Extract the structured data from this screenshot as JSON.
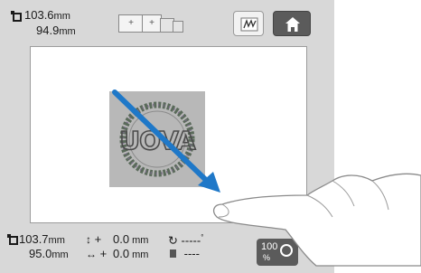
{
  "top": {
    "design_width": "103.6",
    "design_height": "94.9",
    "unit": "mm",
    "hoop_small_label": "+",
    "hoop_large_label": "+"
  },
  "bottom": {
    "width_value": "103.7",
    "height_value": "95.0",
    "unit": "mm",
    "offset_v_label": "+",
    "offset_v_value": "0.0",
    "offset_h_label": "+",
    "offset_h_value": "0.0",
    "rotation_value": "-----",
    "rotation_unit": "°",
    "density_value": "----",
    "zoom_value": "100",
    "zoom_unit": "%"
  },
  "design": {
    "monogram": "UOVA"
  },
  "colors": {
    "panel": "#d8d8d8",
    "arrow": "#1f78c8",
    "home_button": "#5b5b5b"
  },
  "icons": [
    "frame-size-icon",
    "hoop-icon",
    "stitch-icon",
    "home-icon",
    "rotate-icon",
    "density-icon",
    "swipe-arrow-icon",
    "finger-hand-icon"
  ]
}
